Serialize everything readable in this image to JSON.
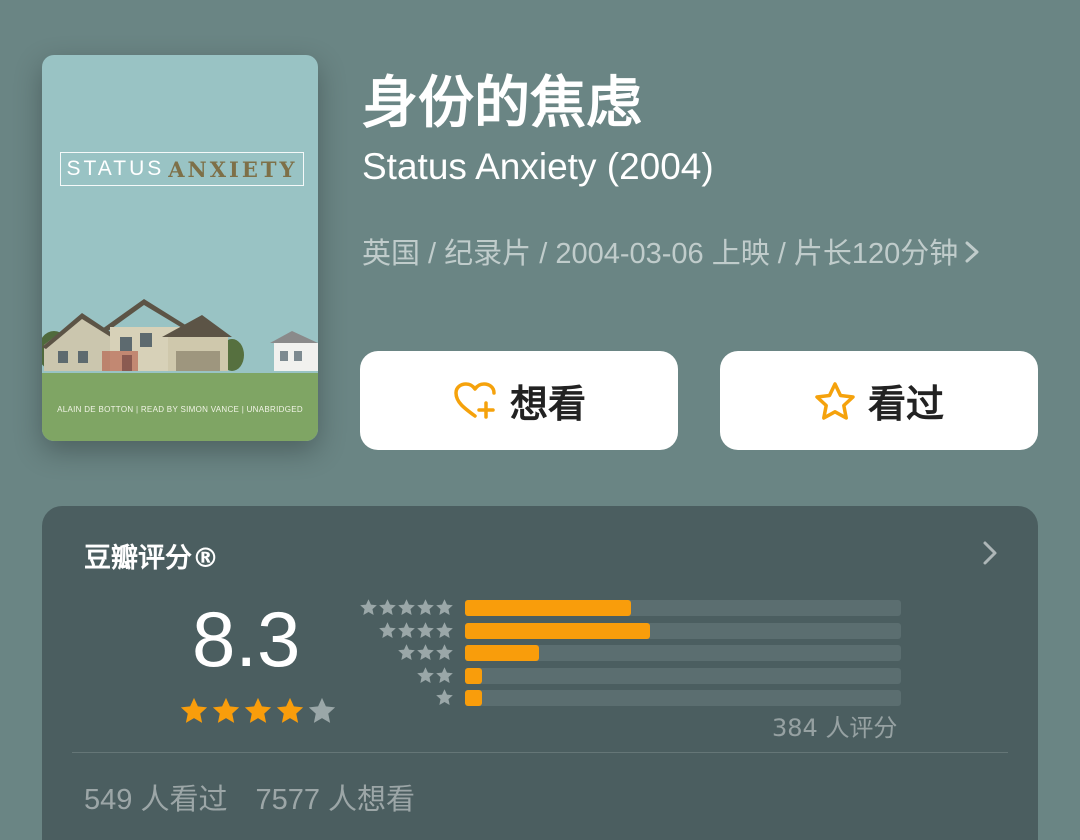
{
  "movie": {
    "title_cn": "身份的焦虑",
    "title_en": "Status Anxiety (2004)",
    "meta_line": "英国 / 纪录片 / 2004-03-06 上映 / 片长120分钟"
  },
  "poster": {
    "title_part1": "STATUS",
    "title_part2": "ANXIETY",
    "credits": "ALAIN DE BOTTON   |   READ BY SIMON VANCE   |   UNABRIDGED"
  },
  "actions": {
    "want_label": "想看",
    "seen_label": "看过"
  },
  "rating": {
    "section_title": "豆瓣评分®",
    "score": "8.3",
    "score_stars": 4,
    "distribution_fraction": [
      0.38,
      0.425,
      0.17,
      0.038,
      0.038
    ],
    "count_text": "384 人评分",
    "seen_text": "549 人看过",
    "want_text": "7577 人想看"
  },
  "colors": {
    "background": "#6a8584",
    "card": "#4b5e60",
    "accent_orange": "#f99d0b",
    "star_grey": "#9aa7a8"
  },
  "icons": {
    "want": "heart-plus-icon",
    "seen": "star-outline-icon",
    "section_more": "chevron-right-icon",
    "meta_more": "chevron-right-icon"
  }
}
